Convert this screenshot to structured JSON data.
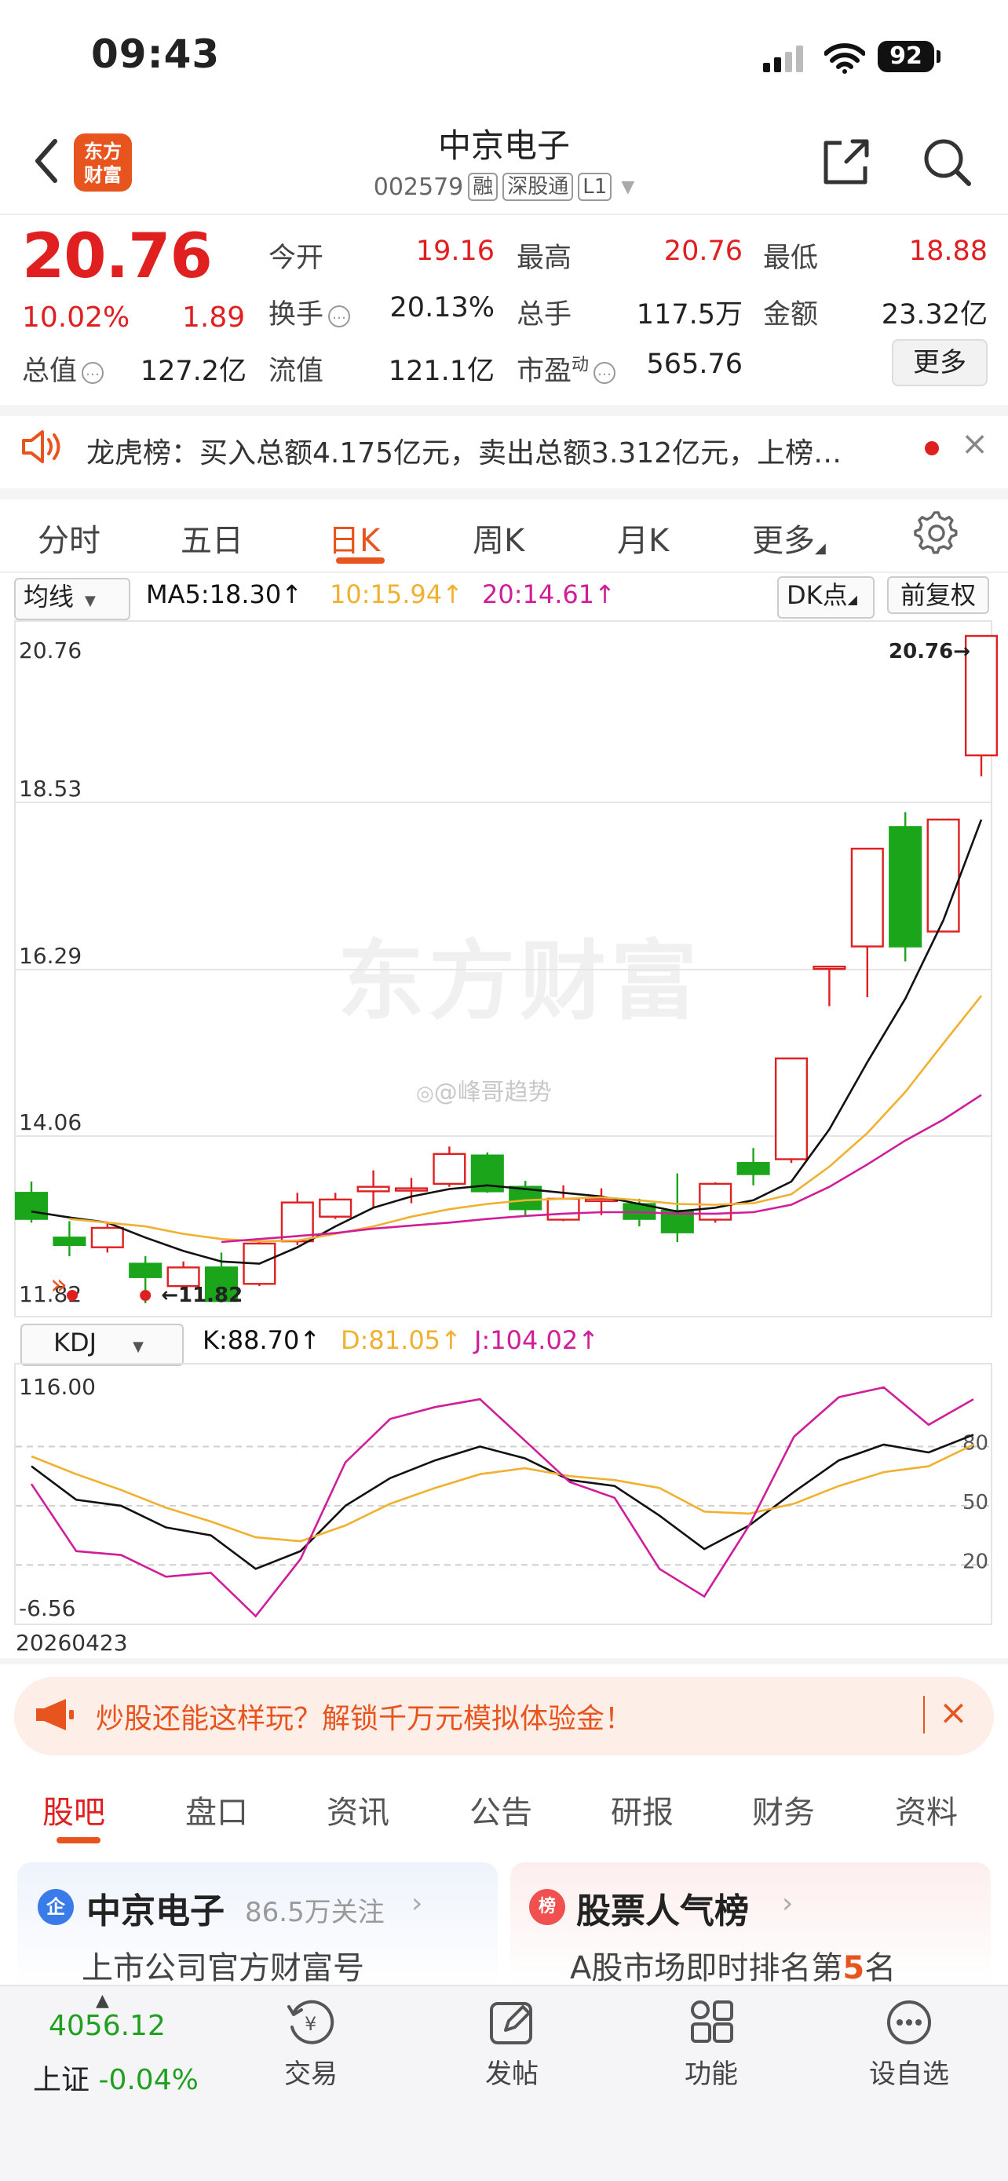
{
  "status_bar": {
    "time": "09:43",
    "battery": "92"
  },
  "header": {
    "logo": "东方财富",
    "stock_name": "中京电子",
    "stock_code": "002579",
    "tags": [
      "融",
      "深股通",
      "L1"
    ]
  },
  "quote": {
    "price": "20.76",
    "change_pct": "10.02%",
    "change": "1.89",
    "fields": [
      {
        "label": "今开",
        "value": "19.16",
        "red": true
      },
      {
        "label": "最高",
        "value": "20.76",
        "red": true
      },
      {
        "label": "最低",
        "value": "18.88",
        "red": true
      },
      {
        "label": "换手",
        "value": "20.13%",
        "red": false
      },
      {
        "label": "总手",
        "value": "117.5万",
        "red": false
      },
      {
        "label": "金额",
        "value": "23.32亿",
        "red": false
      },
      {
        "label": "总值",
        "value": "127.2亿",
        "red": false
      },
      {
        "label": "流值",
        "value": "121.1亿",
        "red": false
      },
      {
        "label": "市盈",
        "sup": "动",
        "value": "565.76",
        "red": false
      }
    ],
    "more_label": "更多"
  },
  "dragon_tiger": {
    "text": "龙虎榜：买入总额4.175亿元，卖出总额3.312亿元，上榜…"
  },
  "chart_tabs": [
    {
      "label": "分时"
    },
    {
      "label": "五日"
    },
    {
      "label": "日K"
    },
    {
      "label": "周K"
    },
    {
      "label": "月K"
    },
    {
      "label": "更多"
    }
  ],
  "ma_bar": {
    "selector": "均线",
    "ma5": "MA5:18.30",
    "ma10": "10:15.94",
    "ma20": "20:14.61",
    "dk_label": "DK点",
    "adjust_label": "前复权"
  },
  "kdj_bar": {
    "selector": "KDJ",
    "k": "K:88.70",
    "d": "D:81.05",
    "j": "J:104.02"
  },
  "watermark": "东方财富",
  "weibo_mark": "@峰哥趋势",
  "chart_data": [
    {
      "type": "candlestick",
      "y_ticks": [
        "20.76",
        "18.53",
        "16.29",
        "14.06",
        "11.82"
      ],
      "ylim": [
        11.82,
        20.76
      ],
      "high_label": "20.76",
      "low_label": "11.82",
      "candles": [
        {
          "o": 13.3,
          "c": 12.95,
          "h": 13.45,
          "l": 12.9
        },
        {
          "o": 12.7,
          "c": 12.6,
          "h": 12.92,
          "l": 12.45
        },
        {
          "o": 12.57,
          "c": 12.83,
          "h": 12.9,
          "l": 12.5
        },
        {
          "o": 12.35,
          "c": 12.17,
          "h": 12.45,
          "l": 11.82
        },
        {
          "o": 12.05,
          "c": 12.3,
          "h": 12.38,
          "l": 12.0
        },
        {
          "o": 12.3,
          "c": 11.85,
          "h": 12.5,
          "l": 11.83
        },
        {
          "o": 12.08,
          "c": 12.62,
          "h": 12.66,
          "l": 12.05
        },
        {
          "o": 12.65,
          "c": 13.17,
          "h": 13.3,
          "l": 12.6
        },
        {
          "o": 12.98,
          "c": 13.21,
          "h": 13.3,
          "l": 12.95
        },
        {
          "o": 13.32,
          "c": 13.38,
          "h": 13.6,
          "l": 13.1
        },
        {
          "o": 13.34,
          "c": 13.36,
          "h": 13.5,
          "l": 13.16
        },
        {
          "o": 13.42,
          "c": 13.82,
          "h": 13.92,
          "l": 13.38
        },
        {
          "o": 13.8,
          "c": 13.32,
          "h": 13.84,
          "l": 13.3
        },
        {
          "o": 13.38,
          "c": 13.08,
          "h": 13.46,
          "l": 12.98
        },
        {
          "o": 12.94,
          "c": 13.22,
          "h": 13.4,
          "l": 12.92
        },
        {
          "o": 13.2,
          "c": 13.22,
          "h": 13.36,
          "l": 13.0
        },
        {
          "o": 13.15,
          "c": 12.95,
          "h": 13.22,
          "l": 12.85
        },
        {
          "o": 13.06,
          "c": 12.77,
          "h": 13.56,
          "l": 12.64
        },
        {
          "o": 12.94,
          "c": 13.42,
          "h": 13.44,
          "l": 12.9
        },
        {
          "o": 13.7,
          "c": 13.55,
          "h": 13.9,
          "l": 13.4
        },
        {
          "o": 13.75,
          "c": 15.1,
          "h": 15.1,
          "l": 13.7
        },
        {
          "o": 16.33,
          "c": 16.33,
          "h": 16.33,
          "l": 15.8
        },
        {
          "o": 16.6,
          "c": 17.91,
          "h": 17.91,
          "l": 15.92
        },
        {
          "o": 18.2,
          "c": 16.6,
          "h": 18.4,
          "l": 16.4
        },
        {
          "o": 16.8,
          "c": 18.3,
          "h": 18.3,
          "l": 16.8
        },
        {
          "o": 19.16,
          "c": 20.76,
          "h": 20.76,
          "l": 18.88
        }
      ],
      "series": [
        {
          "name": "MA5",
          "color": "#111111",
          "values": [
            13.05,
            12.97,
            12.9,
            12.7,
            12.52,
            12.38,
            12.35,
            12.57,
            12.85,
            13.1,
            13.25,
            13.35,
            13.4,
            13.35,
            13.3,
            13.25,
            13.15,
            13.05,
            13.1,
            13.2,
            13.45,
            14.15,
            15.05,
            15.9,
            16.95,
            18.3
          ]
        },
        {
          "name": "10",
          "color": "#f0b030",
          "values": [
            null,
            12.95,
            12.9,
            12.85,
            12.75,
            12.68,
            12.65,
            12.66,
            12.75,
            12.85,
            12.98,
            13.08,
            13.15,
            13.2,
            13.22,
            13.24,
            13.2,
            13.15,
            13.14,
            13.16,
            13.28,
            13.65,
            14.1,
            14.65,
            15.3,
            15.94
          ]
        },
        {
          "name": "20",
          "color": "#d01e9a",
          "values": [
            null,
            null,
            null,
            null,
            null,
            12.64,
            12.68,
            12.72,
            12.76,
            12.82,
            12.86,
            12.9,
            12.95,
            12.99,
            13.02,
            13.04,
            13.04,
            13.02,
            13.02,
            13.04,
            13.14,
            13.38,
            13.68,
            14.0,
            14.28,
            14.61
          ]
        }
      ]
    },
    {
      "type": "line",
      "title": "KDJ",
      "y_ticks": [
        "116.00",
        "-6.56"
      ],
      "right_ticks": [
        "80",
        "50",
        "20"
      ],
      "ylim": [
        -6.56,
        116.0
      ],
      "x_label": "20260423",
      "series": [
        {
          "name": "K",
          "color": "#111111",
          "values": [
            70,
            53,
            50,
            39,
            35,
            18,
            27,
            50,
            64,
            73,
            80,
            74,
            63,
            60,
            45,
            28,
            40,
            57,
            73,
            81,
            77,
            86
          ]
        },
        {
          "name": "D",
          "color": "#f0b030",
          "values": [
            75,
            66,
            58,
            49,
            42,
            34,
            32,
            40,
            51,
            59,
            66,
            69,
            65,
            63,
            59,
            47,
            46,
            51,
            60,
            67,
            70,
            81
          ]
        },
        {
          "name": "J",
          "color": "#d01e9a",
          "values": [
            61,
            27,
            25,
            14,
            16,
            -6,
            23,
            72,
            94,
            100,
            104,
            83,
            62,
            54,
            18,
            4,
            40,
            85,
            105,
            110,
            91,
            104
          ]
        }
      ]
    }
  ],
  "promo": {
    "text": "炒股还能这样玩？解锁千万元模拟体验金！"
  },
  "bottom_tabs": [
    {
      "label": "股吧"
    },
    {
      "label": "盘口"
    },
    {
      "label": "资讯"
    },
    {
      "label": "公告"
    },
    {
      "label": "研报"
    },
    {
      "label": "财务"
    },
    {
      "label": "资料"
    }
  ],
  "cards": [
    {
      "icon": "企",
      "title": "中京电子",
      "meta": "86.5万关注",
      "sub": "上市公司官方财富号"
    },
    {
      "icon": "榜",
      "title": "股票人气榜",
      "sub_pre": "A股市场即时排名第",
      "sub_num": "5",
      "sub_post": "名"
    }
  ],
  "index": {
    "value": "4056.12",
    "name": "上证",
    "change": "-0.04%"
  },
  "nav": [
    {
      "label": "交易"
    },
    {
      "label": "发帖"
    },
    {
      "label": "功能"
    },
    {
      "label": "设自选"
    }
  ]
}
